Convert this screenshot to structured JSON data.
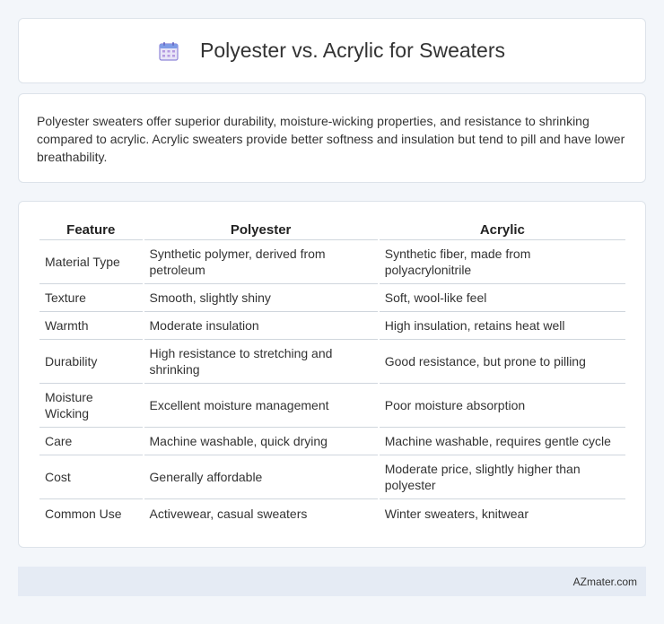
{
  "header": {
    "title": "Polyester vs. Acrylic for Sweaters",
    "icon": "calendar-icon"
  },
  "intro": {
    "text": "Polyester sweaters offer superior durability, moisture-wicking properties, and resistance to shrinking compared to acrylic. Acrylic sweaters provide better softness and insulation but tend to pill and have lower breathability."
  },
  "table": {
    "headers": [
      "Feature",
      "Polyester",
      "Acrylic"
    ],
    "rows": [
      [
        "Material Type",
        "Synthetic polymer, derived from petroleum",
        "Synthetic fiber, made from polyacrylonitrile"
      ],
      [
        "Texture",
        "Smooth, slightly shiny",
        "Soft, wool-like feel"
      ],
      [
        "Warmth",
        "Moderate insulation",
        "High insulation, retains heat well"
      ],
      [
        "Durability",
        "High resistance to stretching and shrinking",
        "Good resistance, but prone to pilling"
      ],
      [
        "Moisture Wicking",
        "Excellent moisture management",
        "Poor moisture absorption"
      ],
      [
        "Care",
        "Machine washable, quick drying",
        "Machine washable, requires gentle cycle"
      ],
      [
        "Cost",
        "Generally affordable",
        "Moderate price, slightly higher than polyester"
      ],
      [
        "Common Use",
        "Activewear, casual sweaters",
        "Winter sweaters, knitwear"
      ]
    ]
  },
  "footer": {
    "brand": "AZmater.com"
  }
}
